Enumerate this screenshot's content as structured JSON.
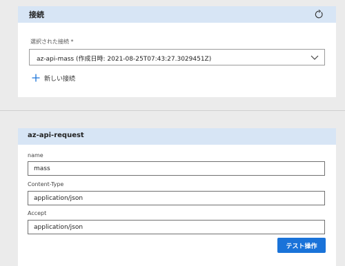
{
  "connection": {
    "header_title": "接続",
    "selected_label": "選択された接続 *",
    "selected_value": "az-api-mass (作成日時: 2021-08-25T07:43:27.3029451Z)",
    "new_connection_label": "新しい接続",
    "icons": {
      "refresh": "refresh-icon",
      "chevron": "chevron-down-icon",
      "plus": "plus-icon"
    }
  },
  "request": {
    "header_title": "az-api-request",
    "fields": [
      {
        "label": "name",
        "value": "mass"
      },
      {
        "label": "Content-Type",
        "value": "application/json"
      },
      {
        "label": "Accept",
        "value": "application/json"
      }
    ],
    "test_button_label": "テスト操作"
  },
  "colors": {
    "header_bg": "#d7e5f5",
    "accent": "#1a73d9",
    "page_bg": "#ebebeb"
  }
}
